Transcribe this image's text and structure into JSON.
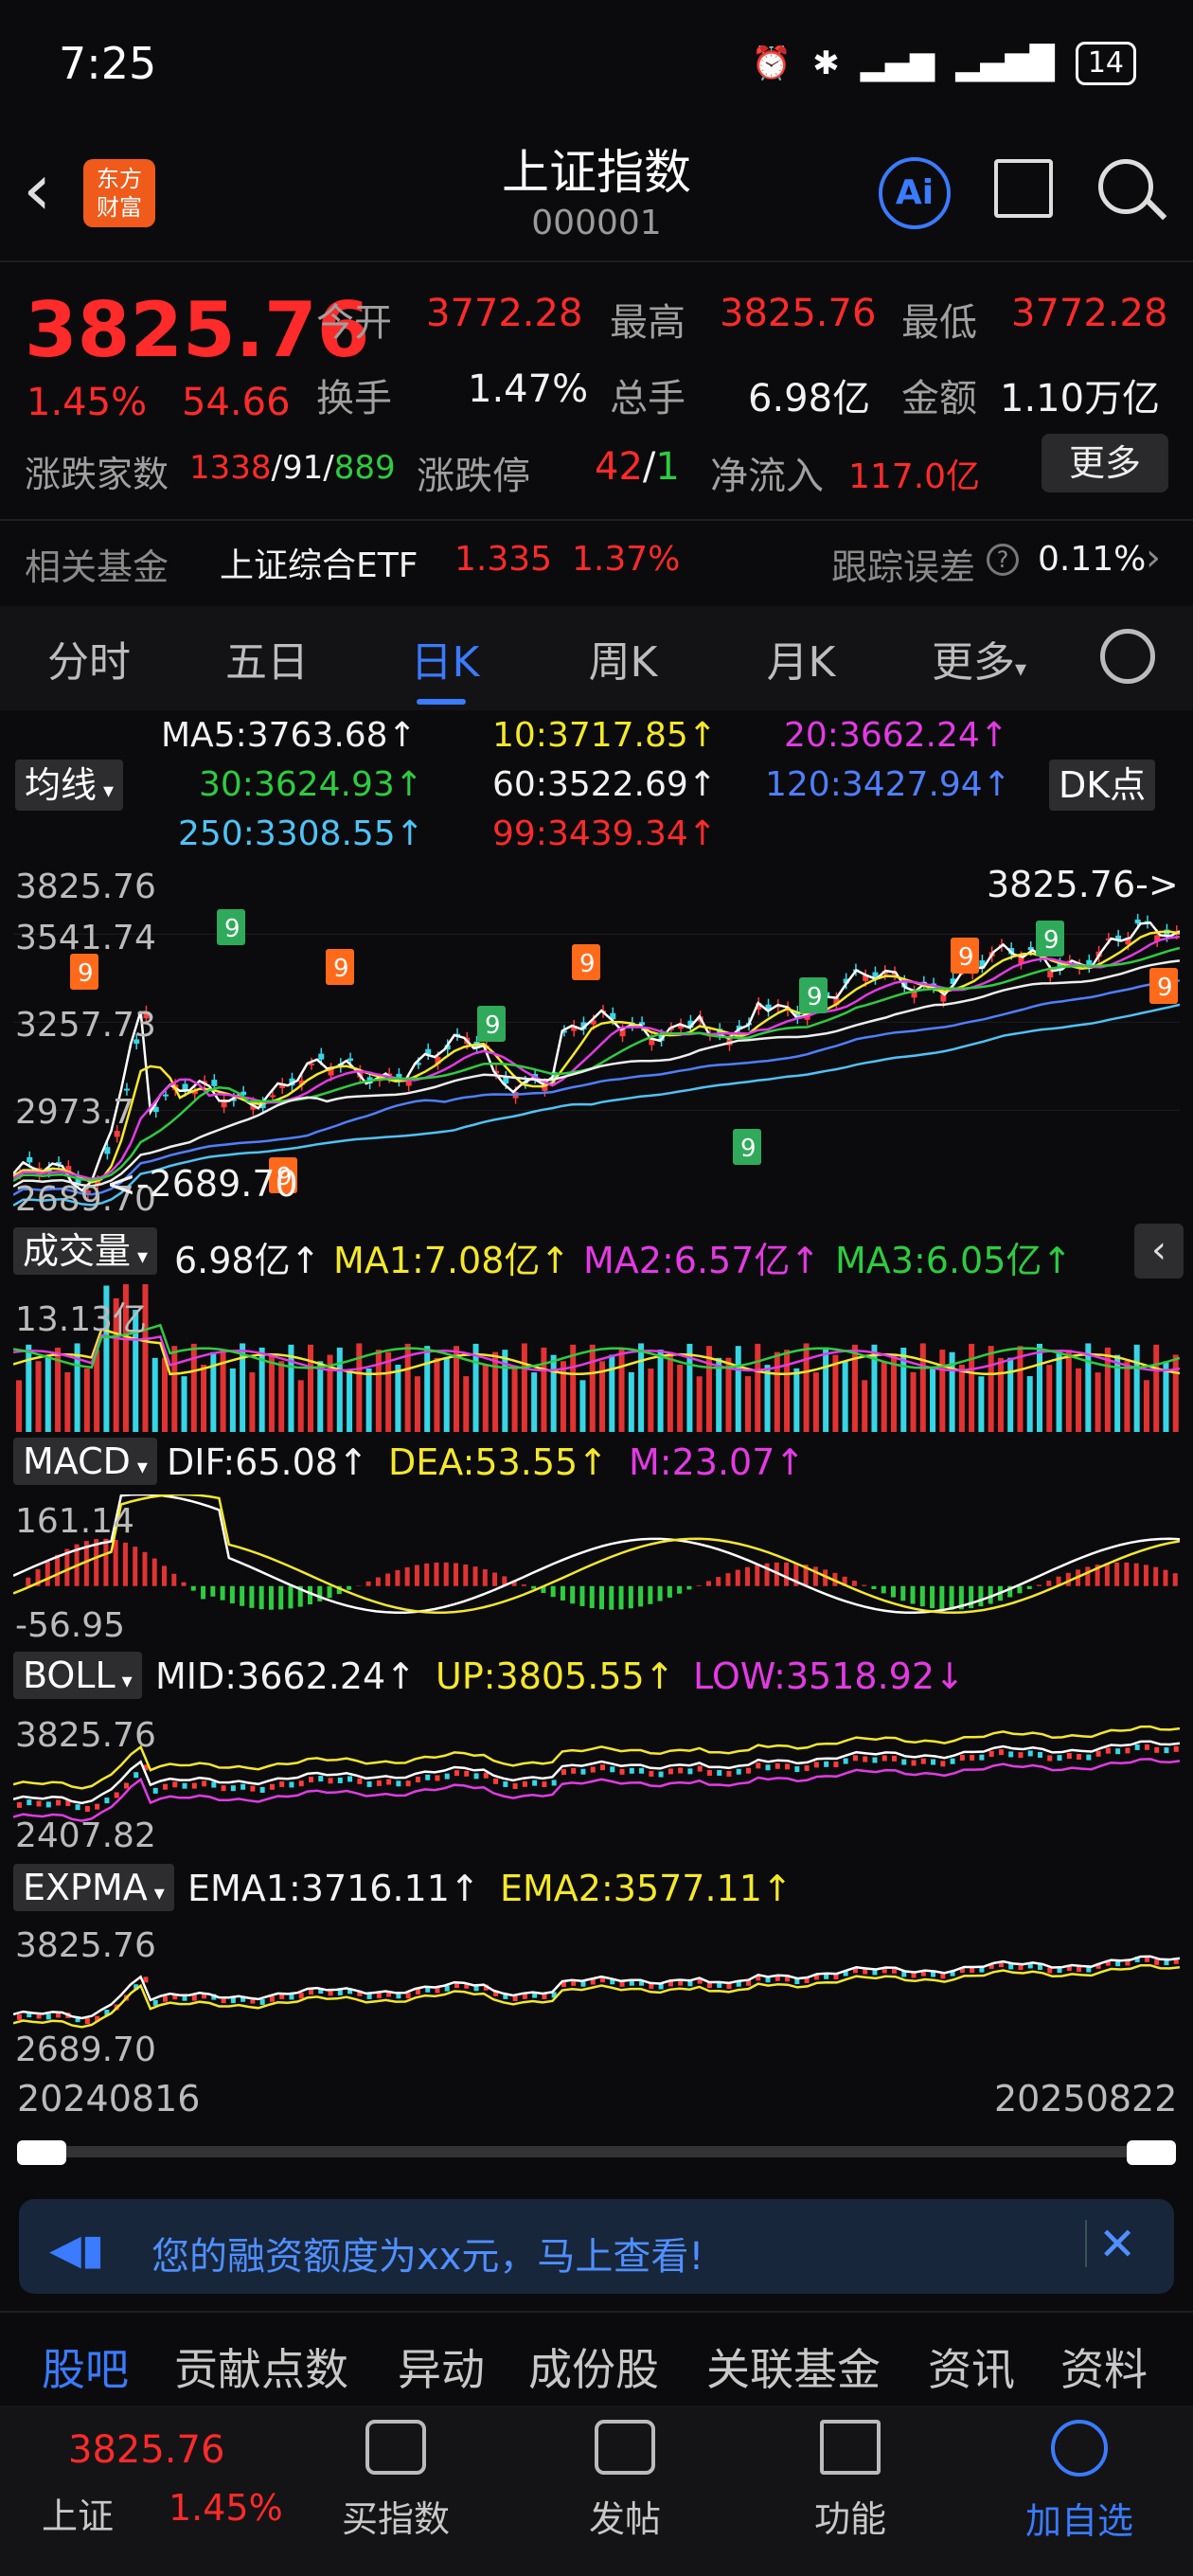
{
  "status": {
    "time": "7:25",
    "battery": "14"
  },
  "header": {
    "title": "上证指数",
    "code": "000001",
    "ai_label": "Ai",
    "logo_line1": "东方",
    "logo_line2": "财富"
  },
  "quote": {
    "price": "3825.76",
    "pct": "1.45%",
    "change": "54.66",
    "open_label": "今开",
    "open": "3772.28",
    "high_label": "最高",
    "high": "3825.76",
    "low_label": "最低",
    "low": "3772.28",
    "turnover_label": "换手",
    "turnover": "1.47%",
    "volume_label": "总手",
    "volume": "6.98亿",
    "amount_label": "金额",
    "amount": "1.10万亿",
    "breadth_label": "涨跌家数",
    "up_count": "1338",
    "flat_count": "91",
    "down_count": "889",
    "limit_label": "涨跌停",
    "limit_up": "42",
    "limit_down": "1",
    "inflow_label": "净流入",
    "inflow": "117.0亿",
    "more_label": "更多"
  },
  "fund": {
    "label": "相关基金",
    "name": "上证综合ETF",
    "price": "1.335",
    "pct": "1.37%",
    "tracking_label": "跟踪误差",
    "tracking": "0.11%"
  },
  "tabs": [
    "分时",
    "五日",
    "日K",
    "周K",
    "月K",
    "更多"
  ],
  "ma": {
    "selector": "均线",
    "dk_label": "DK点",
    "ma5": "MA5:3763.68↑",
    "ma10": "10:3717.85↑",
    "ma20": "20:3662.24↑",
    "ma30": "30:3624.93↑",
    "ma60": "60:3522.69↑",
    "ma120": "120:3427.94↑",
    "ma250": "250:3308.55↑",
    "ma99": "99:3439.34↑"
  },
  "main_chart": {
    "y_labels": [
      "3825.76",
      "3541.74",
      "3257.73",
      "2973.7",
      "2689.70"
    ],
    "max_marker": "3825.76->",
    "min_marker": "<-2689.70"
  },
  "volume_panel": {
    "selector": "成交量",
    "vol": "6.98亿↑",
    "ma1": "MA1:7.08亿↑",
    "ma2": "MA2:6.57亿↑",
    "ma3": "MA3:6.05亿↑",
    "y_top": "13.13亿"
  },
  "macd_panel": {
    "selector": "MACD",
    "dif": "DIF:65.08↑",
    "dea": "DEA:53.55↑",
    "m": "M:23.07↑",
    "y_top": "161.14",
    "y_bottom": "-56.95"
  },
  "boll_panel": {
    "selector": "BOLL",
    "mid": "MID:3662.24↑",
    "up": "UP:3805.55↑",
    "low": "LOW:3518.92↓",
    "y_top": "3825.76",
    "y_bottom": "2407.82"
  },
  "expma_panel": {
    "selector": "EXPMA",
    "ema1": "EMA1:3716.11↑",
    "ema2": "EMA2:3577.11↑",
    "y_top": "3825.76",
    "y_bottom": "2689.70"
  },
  "dates": {
    "start": "20240816",
    "end": "20250822"
  },
  "ad": {
    "text": "您的融资额度为xx元，马上查看!"
  },
  "bottom_tabs": [
    "股吧",
    "贡献点数",
    "异动",
    "成份股",
    "关联基金",
    "资讯",
    "资料"
  ],
  "nav": {
    "index_price": "3825.76",
    "index_name": "上证",
    "index_pct": "1.45%",
    "buy": "买指数",
    "post": "发帖",
    "func": "功能",
    "add": "加自选"
  },
  "colors": {
    "up": "#ff2a2a",
    "down": "#2ecc40",
    "accent": "#3a7bff"
  }
}
